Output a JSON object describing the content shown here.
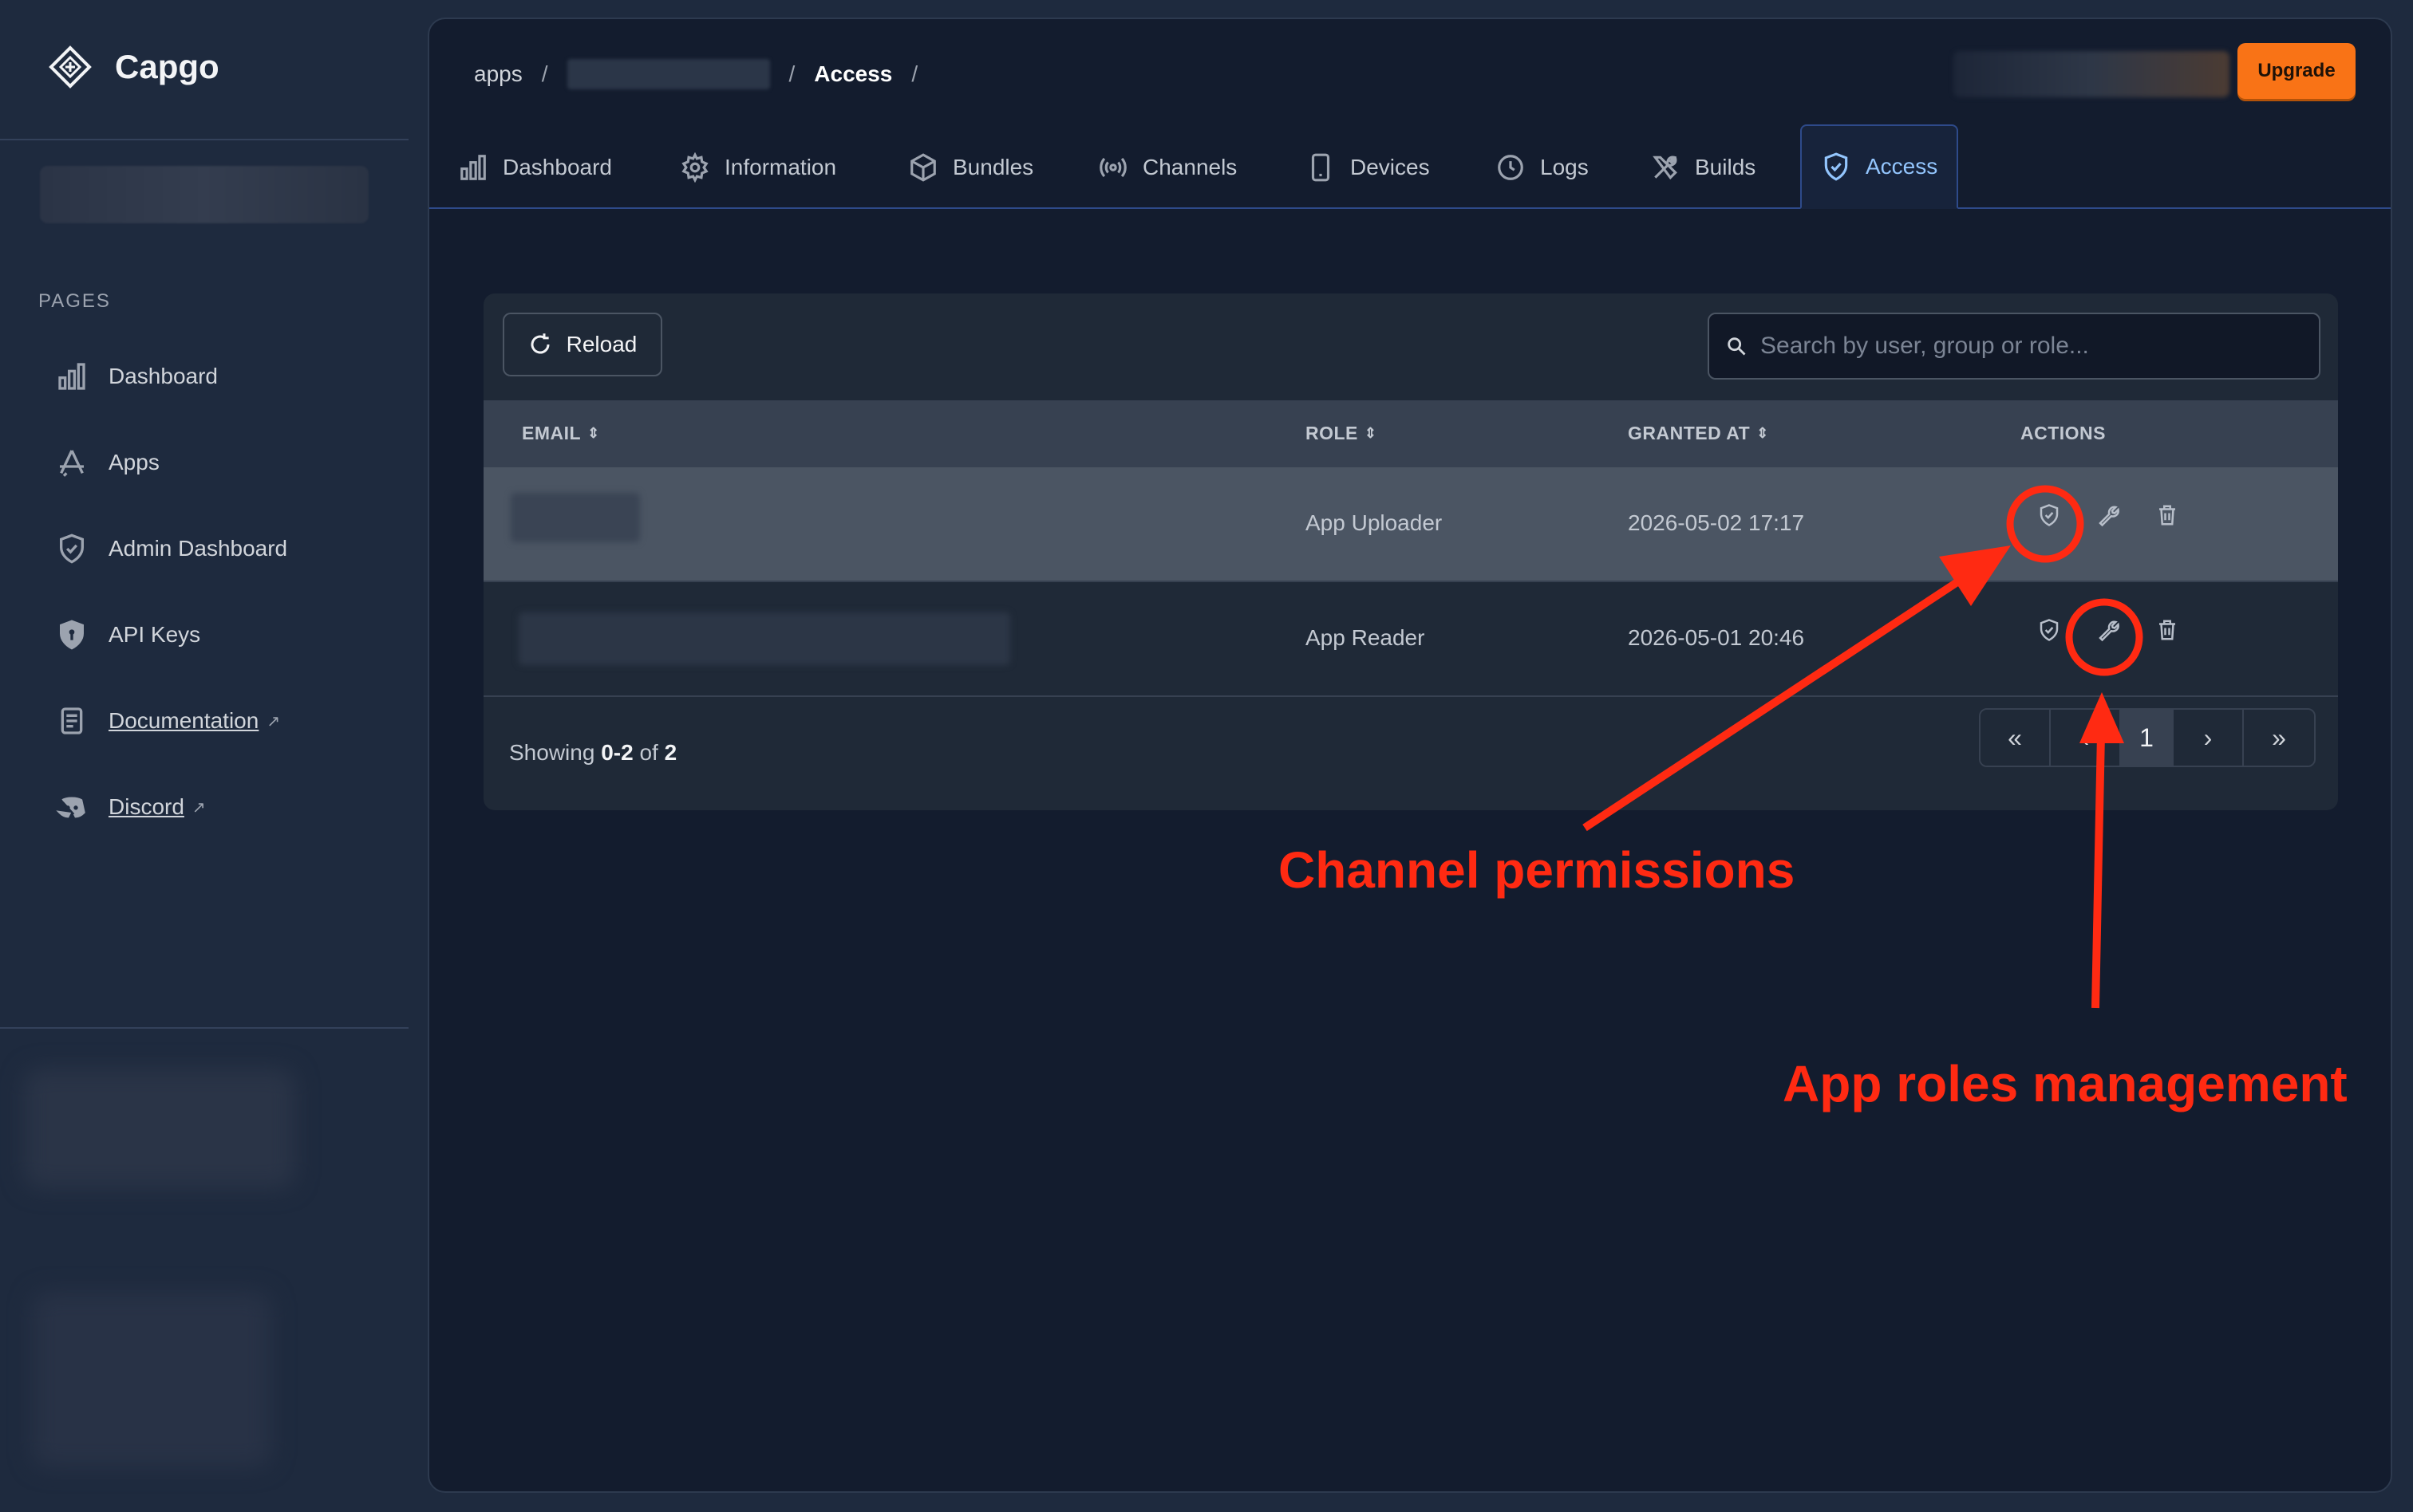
{
  "sidebar": {
    "brand": "Capgo",
    "section_label": "PAGES",
    "items": [
      {
        "label": "Dashboard",
        "icon": "bar-chart-icon"
      },
      {
        "label": "Apps",
        "icon": "app-store-icon"
      },
      {
        "label": "Admin Dashboard",
        "icon": "shield-check-icon"
      },
      {
        "label": "API Keys",
        "icon": "shield-key-icon"
      },
      {
        "label": "Documentation",
        "icon": "document-icon",
        "external": true
      },
      {
        "label": "Discord",
        "icon": "discord-icon",
        "external": true
      }
    ]
  },
  "header": {
    "breadcrumb": {
      "root": "apps",
      "sep": "/",
      "current": "Access"
    },
    "upgrade_label": "Upgrade"
  },
  "tabs": [
    {
      "label": "Dashboard",
      "icon": "bar-chart-icon"
    },
    {
      "label": "Information",
      "icon": "gear-icon"
    },
    {
      "label": "Bundles",
      "icon": "box-icon"
    },
    {
      "label": "Channels",
      "icon": "broadcast-icon"
    },
    {
      "label": "Devices",
      "icon": "phone-icon"
    },
    {
      "label": "Logs",
      "icon": "clock-icon"
    },
    {
      "label": "Builds",
      "icon": "tools-icon"
    },
    {
      "label": "Access",
      "icon": "shield-check-icon",
      "active": true
    }
  ],
  "toolbar": {
    "reload_label": "Reload",
    "search_placeholder": "Search by user, group or role..."
  },
  "table": {
    "columns": [
      "EMAIL",
      "ROLE",
      "GRANTED AT",
      "ACTIONS"
    ],
    "rows": [
      {
        "role": "App Uploader",
        "granted_at": "2026-05-02 17:17"
      },
      {
        "role": "App Reader",
        "granted_at": "2026-05-01 20:46"
      }
    ]
  },
  "pagination": {
    "showing_prefix": "Showing",
    "range": "0-2",
    "of_word": "of",
    "total": "2",
    "current_page": "1",
    "first": "«",
    "prev": "‹",
    "next": "›",
    "last": "»"
  },
  "annotations": {
    "channel_permissions": "Channel permissions",
    "app_roles": "App roles management",
    "color": "#ff2a12"
  },
  "colors": {
    "accent": "#93c5fd",
    "upgrade": "#f97316"
  }
}
